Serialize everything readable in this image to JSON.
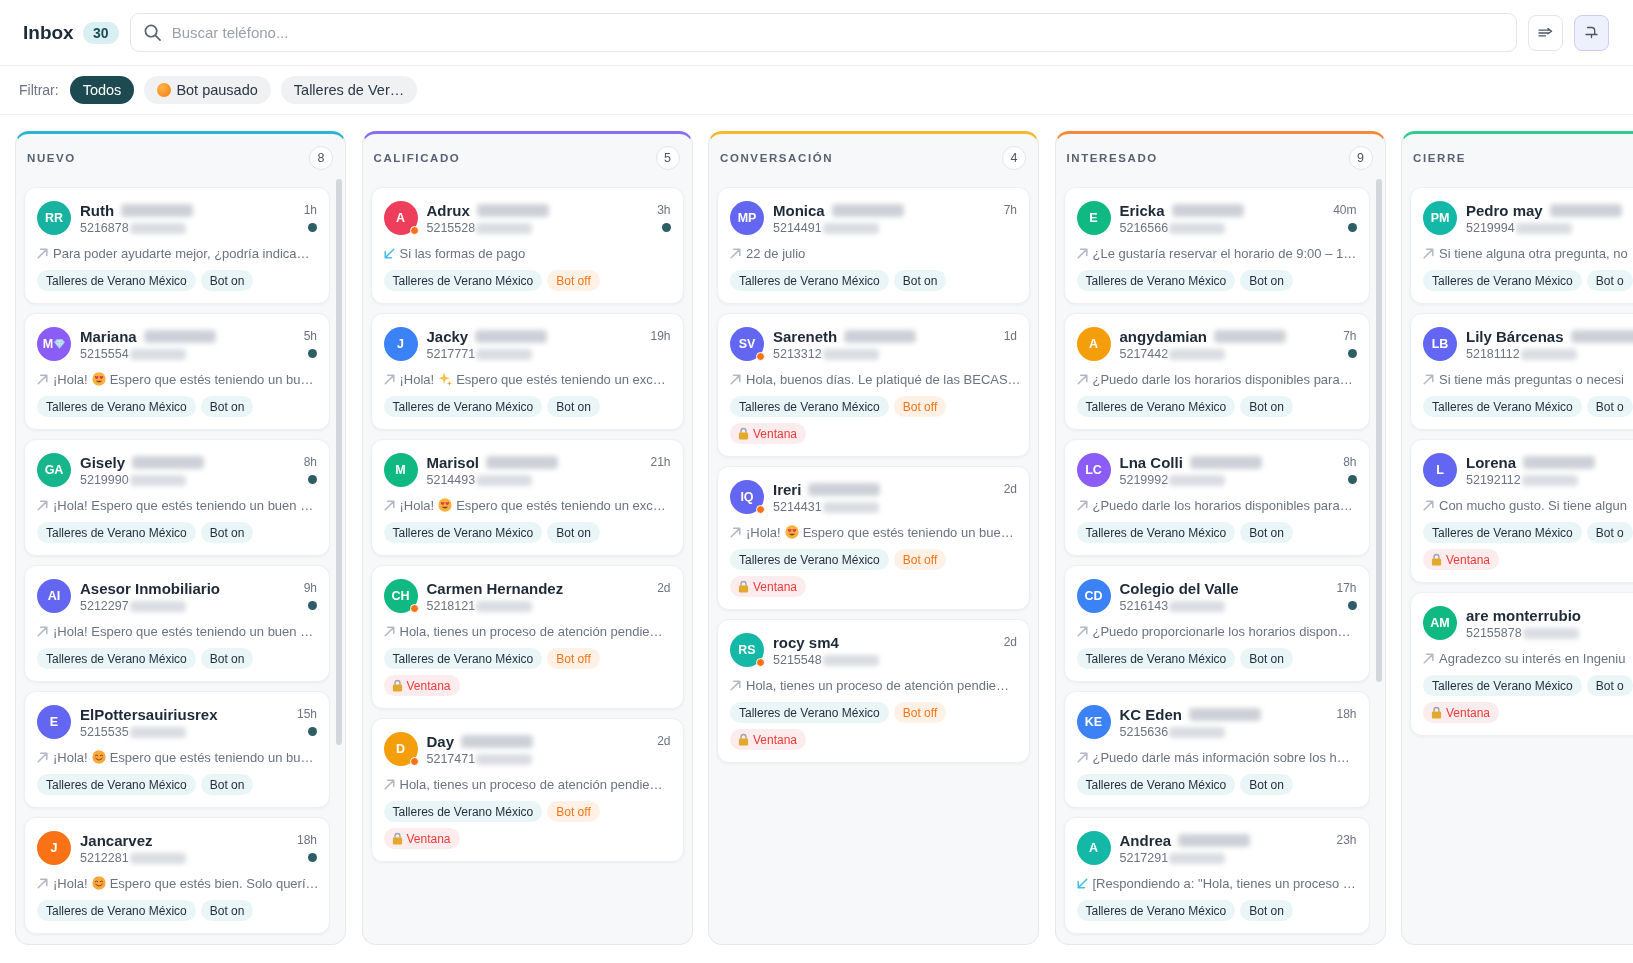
{
  "header": {
    "title": "Inbox",
    "count": "30",
    "search": {
      "placeholder": "Buscar teléfono..."
    },
    "toolbar": [
      {
        "kind": "sort",
        "on": false
      },
      {
        "kind": "lamp",
        "on": true
      }
    ]
  },
  "filters": {
    "label": "Filtrar:",
    "chips": [
      {
        "label": "Todos",
        "selected": true,
        "dot": false
      },
      {
        "label": "Bot pausado",
        "selected": false,
        "dot": true
      },
      {
        "label": "Talleres de Ver…",
        "selected": false,
        "dot": false
      }
    ]
  },
  "columns": [
    {
      "title": "NUEVO",
      "count": "8",
      "color": "#2bb5d2",
      "cards": [
        {
          "initials": "RR",
          "color": "#17b3a0",
          "name": "Ruth",
          "name_redacted": true,
          "phone": "5216878",
          "time": "1h",
          "unread": true,
          "paused": false,
          "incoming": false,
          "preview": [
            {
              "kind": "text",
              "text": "Para poder ayudarte mejor, ¿podría indica…"
            }
          ],
          "tags": [
            {
              "label": "Talleres de Verano México",
              "kind": "group"
            },
            {
              "label": "Bot on",
              "kind": "on"
            }
          ]
        },
        {
          "initials": "M",
          "emblem": {
            "kind": "gem"
          },
          "color": "#8b5cf6",
          "name": "Mariana",
          "name_redacted": true,
          "phone": "5215554",
          "time": "5h",
          "unread": true,
          "paused": false,
          "incoming": false,
          "preview": [
            {
              "kind": "text",
              "text": "¡Hola!"
            },
            {
              "kind": "hearts"
            },
            {
              "kind": "text",
              "text": "Espero que estés teniendo un bu…"
            }
          ],
          "tags": [
            {
              "label": "Talleres de Verano México",
              "kind": "group"
            },
            {
              "label": "Bot on",
              "kind": "on"
            }
          ]
        },
        {
          "initials": "GA",
          "color": "#16b58c",
          "name": "Gisely",
          "name_redacted": true,
          "phone": "5219990",
          "time": "8h",
          "unread": true,
          "paused": false,
          "incoming": false,
          "preview": [
            {
              "kind": "text",
              "text": "¡Hola! Espero que estés teniendo un buen …"
            }
          ],
          "tags": [
            {
              "label": "Talleres de Verano México",
              "kind": "group"
            },
            {
              "label": "Bot on",
              "kind": "on"
            }
          ]
        },
        {
          "initials": "AI",
          "color": "#6366f1",
          "name": "Asesor Inmobiliario",
          "name_redacted": false,
          "phone": "5212297",
          "time": "9h",
          "unread": true,
          "paused": false,
          "incoming": false,
          "preview": [
            {
              "kind": "text",
              "text": "¡Hola! Espero que estés teniendo un buen …"
            }
          ],
          "tags": [
            {
              "label": "Talleres de Verano México",
              "kind": "group"
            },
            {
              "label": "Bot on",
              "kind": "on"
            }
          ]
        },
        {
          "initials": "E",
          "color": "#6366f1",
          "name": "ElPottersauiriusrex",
          "name_redacted": false,
          "phone": "5215535",
          "time": "15h",
          "unread": true,
          "paused": false,
          "incoming": false,
          "preview": [
            {
              "kind": "text",
              "text": "¡Hola!"
            },
            {
              "kind": "smile"
            },
            {
              "kind": "text",
              "text": "Espero que estés teniendo un bu…"
            }
          ],
          "tags": [
            {
              "label": "Talleres de Verano México",
              "kind": "group"
            },
            {
              "label": "Bot on",
              "kind": "on"
            }
          ]
        },
        {
          "initials": "J",
          "color": "#f97316",
          "name": "Jancarvez",
          "name_redacted": false,
          "phone": "5212281",
          "time": "18h",
          "unread": true,
          "paused": false,
          "incoming": false,
          "preview": [
            {
              "kind": "text",
              "text": "¡Hola!"
            },
            {
              "kind": "smile"
            },
            {
              "kind": "text",
              "text": "Espero que estés bien. Solo querí…"
            }
          ],
          "tags": [
            {
              "label": "Talleres de Verano México",
              "kind": "group"
            },
            {
              "label": "Bot on",
              "kind": "on"
            }
          ]
        }
      ]
    },
    {
      "title": "CALIFICADO",
      "count": "5",
      "color": "#8b6cf2",
      "cards": [
        {
          "initials": "A",
          "color": "#ef3e5c",
          "name": "Adrux",
          "name_redacted": true,
          "phone": "5215528",
          "time": "3h",
          "unread": true,
          "paused": true,
          "incoming": true,
          "preview": [
            {
              "kind": "text",
              "text": "Si las formas de pago"
            }
          ],
          "tags": [
            {
              "label": "Talleres de Verano México",
              "kind": "group"
            },
            {
              "label": "Bot off",
              "kind": "off"
            }
          ]
        },
        {
          "initials": "J",
          "color": "#3b82f6",
          "name": "Jacky",
          "name_redacted": true,
          "phone": "5217771",
          "time": "19h",
          "unread": false,
          "paused": false,
          "incoming": false,
          "preview": [
            {
              "kind": "text",
              "text": "¡Hola!"
            },
            {
              "kind": "sparkles"
            },
            {
              "kind": "text",
              "text": "Espero que estés teniendo un exc…"
            }
          ],
          "tags": [
            {
              "label": "Talleres de Verano México",
              "kind": "group"
            },
            {
              "label": "Bot on",
              "kind": "on"
            }
          ]
        },
        {
          "initials": "M",
          "color": "#10b981",
          "name": "Marisol",
          "name_redacted": true,
          "phone": "5214493",
          "time": "21h",
          "unread": false,
          "paused": false,
          "incoming": false,
          "preview": [
            {
              "kind": "text",
              "text": "¡Hola!"
            },
            {
              "kind": "hearts"
            },
            {
              "kind": "text",
              "text": "Espero que estés teniendo un exc…"
            }
          ],
          "tags": [
            {
              "label": "Talleres de Verano México",
              "kind": "group"
            },
            {
              "label": "Bot on",
              "kind": "on"
            }
          ]
        },
        {
          "initials": "CH",
          "color": "#10b981",
          "name": "Carmen Hernandez",
          "name_redacted": false,
          "phone": "5218121",
          "time": "2d",
          "unread": false,
          "paused": true,
          "incoming": false,
          "preview": [
            {
              "kind": "text",
              "text": "Hola, tienes un proceso de atención pendie…"
            }
          ],
          "tags": [
            {
              "label": "Talleres de Verano México",
              "kind": "group"
            },
            {
              "label": "Bot off",
              "kind": "off"
            },
            {
              "label": "Ventana",
              "kind": "window"
            }
          ]
        },
        {
          "initials": "D",
          "color": "#f59e0b",
          "name": "Day",
          "name_redacted": true,
          "phone": "5217471",
          "time": "2d",
          "unread": false,
          "paused": true,
          "incoming": false,
          "preview": [
            {
              "kind": "text",
              "text": "Hola, tienes un proceso de atención pendie…"
            }
          ],
          "tags": [
            {
              "label": "Talleres de Verano México",
              "kind": "group"
            },
            {
              "label": "Bot off",
              "kind": "off"
            },
            {
              "label": "Ventana",
              "kind": "window"
            }
          ]
        }
      ]
    },
    {
      "title": "CONVERSACIÓN",
      "count": "4",
      "color": "#f5b82e",
      "cards": [
        {
          "initials": "MP",
          "color": "#6366f1",
          "name": "Monica",
          "name_redacted": true,
          "phone": "5214491",
          "time": "7h",
          "unread": false,
          "paused": false,
          "incoming": false,
          "preview": [
            {
              "kind": "text",
              "text": "22 de julio"
            }
          ],
          "tags": [
            {
              "label": "Talleres de Verano México",
              "kind": "group"
            },
            {
              "label": "Bot on",
              "kind": "on"
            }
          ]
        },
        {
          "initials": "SV",
          "color": "#6366f1",
          "name": "Sareneth",
          "name_redacted": true,
          "phone": "5213312",
          "time": "1d",
          "unread": false,
          "paused": true,
          "incoming": false,
          "preview": [
            {
              "kind": "text",
              "text": "Hola, buenos días. Le platiqué de las BECAS…"
            }
          ],
          "tags": [
            {
              "label": "Talleres de Verano México",
              "kind": "group"
            },
            {
              "label": "Bot off",
              "kind": "off"
            },
            {
              "label": "Ventana",
              "kind": "window"
            }
          ]
        },
        {
          "initials": "IQ",
          "color": "#6366f1",
          "name": "Ireri",
          "name_redacted": true,
          "phone": "5214431",
          "time": "2d",
          "unread": false,
          "paused": true,
          "incoming": false,
          "preview": [
            {
              "kind": "text",
              "text": "¡Hola!"
            },
            {
              "kind": "hearts"
            },
            {
              "kind": "text",
              "text": "Espero que estés teniendo un bue…"
            }
          ],
          "tags": [
            {
              "label": "Talleres de Verano México",
              "kind": "group"
            },
            {
              "label": "Bot off",
              "kind": "off"
            },
            {
              "label": "Ventana",
              "kind": "window"
            }
          ]
        },
        {
          "initials": "RS",
          "color": "#14b8a6",
          "name": "rocy sm4",
          "name_redacted": false,
          "phone": "5215548",
          "time": "2d",
          "unread": false,
          "paused": true,
          "incoming": false,
          "preview": [
            {
              "kind": "text",
              "text": "Hola, tienes un proceso de atención pendie…"
            }
          ],
          "tags": [
            {
              "label": "Talleres de Verano México",
              "kind": "group"
            },
            {
              "label": "Bot off",
              "kind": "off"
            },
            {
              "label": "Ventana",
              "kind": "window"
            }
          ]
        }
      ]
    },
    {
      "title": "INTERESADO",
      "count": "9",
      "color": "#f7893b",
      "cards": [
        {
          "initials": "E",
          "color": "#10b981",
          "name": "Ericka",
          "name_redacted": true,
          "phone": "5216566",
          "time": "40m",
          "unread": true,
          "paused": false,
          "incoming": false,
          "preview": [
            {
              "kind": "text",
              "text": "¿Le gustaría reservar el horario de 9:00 – 1…"
            }
          ],
          "tags": [
            {
              "label": "Talleres de Verano México",
              "kind": "group"
            },
            {
              "label": "Bot on",
              "kind": "on"
            }
          ]
        },
        {
          "initials": "A",
          "color": "#f59e0b",
          "name": "angydamian",
          "name_redacted": true,
          "phone": "5217442",
          "time": "7h",
          "unread": true,
          "paused": false,
          "incoming": false,
          "preview": [
            {
              "kind": "text",
              "text": "¿Puedo darle los horarios disponibles para…"
            }
          ],
          "tags": [
            {
              "label": "Talleres de Verano México",
              "kind": "group"
            },
            {
              "label": "Bot on",
              "kind": "on"
            }
          ]
        },
        {
          "initials": "LC",
          "color": "#8b5cf6",
          "name": "Lna Colli",
          "name_redacted": true,
          "phone": "5219992",
          "time": "8h",
          "unread": true,
          "paused": false,
          "incoming": false,
          "preview": [
            {
              "kind": "text",
              "text": "¿Puedo darle los horarios disponibles para…"
            }
          ],
          "tags": [
            {
              "label": "Talleres de Verano México",
              "kind": "group"
            },
            {
              "label": "Bot on",
              "kind": "on"
            }
          ]
        },
        {
          "initials": "CD",
          "color": "#3b82f6",
          "name": "Colegio del Valle",
          "name_redacted": false,
          "phone": "5216143",
          "time": "17h",
          "unread": true,
          "paused": false,
          "incoming": false,
          "preview": [
            {
              "kind": "text",
              "text": "¿Puedo proporcionarle los horarios dispon…"
            }
          ],
          "tags": [
            {
              "label": "Talleres de Verano México",
              "kind": "group"
            },
            {
              "label": "Bot on",
              "kind": "on"
            }
          ]
        },
        {
          "initials": "KE",
          "color": "#3b82f6",
          "name": "KC Eden",
          "name_redacted": true,
          "phone": "5215636",
          "time": "18h",
          "unread": false,
          "paused": false,
          "incoming": false,
          "preview": [
            {
              "kind": "text",
              "text": "¿Puedo darle más información sobre los h…"
            }
          ],
          "tags": [
            {
              "label": "Talleres de Verano México",
              "kind": "group"
            },
            {
              "label": "Bot on",
              "kind": "on"
            }
          ]
        },
        {
          "initials": "A",
          "color": "#14b8a6",
          "name": "Andrea",
          "name_redacted": true,
          "phone": "5217291",
          "time": "23h",
          "unread": false,
          "paused": false,
          "incoming": true,
          "preview": [
            {
              "kind": "text",
              "text": "[Respondiendo a: \"Hola, tienes un proceso …"
            }
          ],
          "tags": [
            {
              "label": "Talleres de Verano México",
              "kind": "group"
            },
            {
              "label": "Bot on",
              "kind": "on"
            }
          ]
        }
      ]
    },
    {
      "title": "CIERRE",
      "color": "#2ecf8e",
      "cards": [
        {
          "initials": "PM",
          "color": "#14b8a6",
          "name": "Pedro may",
          "name_redacted": true,
          "phone": "5219994",
          "paused": false,
          "incoming": false,
          "preview": [
            {
              "kind": "text",
              "text": "Si tiene alguna otra pregunta, no"
            }
          ],
          "tags": [
            {
              "label": "Talleres de Verano México",
              "kind": "group"
            },
            {
              "label": "Bot o",
              "kind": "on"
            }
          ]
        },
        {
          "initials": "LB",
          "color": "#6366f1",
          "name": "Lily Bárcenas",
          "name_redacted": true,
          "phone": "52181112",
          "paused": false,
          "incoming": false,
          "preview": [
            {
              "kind": "text",
              "text": "Si tiene más preguntas o necesi"
            }
          ],
          "tags": [
            {
              "label": "Talleres de Verano México",
              "kind": "group"
            },
            {
              "label": "Bot o",
              "kind": "on"
            }
          ]
        },
        {
          "initials": "L",
          "color": "#6366f1",
          "name": "Lorena",
          "name_redacted": true,
          "phone": "52192112",
          "paused": false,
          "incoming": false,
          "preview": [
            {
              "kind": "text",
              "text": "Con mucho gusto. Si tiene algun"
            }
          ],
          "tags": [
            {
              "label": "Talleres de Verano México",
              "kind": "group"
            },
            {
              "label": "Bot o",
              "kind": "on"
            },
            {
              "label": "Ventana",
              "kind": "window"
            }
          ]
        },
        {
          "initials": "AM",
          "color": "#10b981",
          "name": "are monterrubio",
          "name_redacted": false,
          "phone": "52155878",
          "paused": false,
          "incoming": false,
          "preview": [
            {
              "kind": "text",
              "text": "Agradezco su interés en Ingeniu"
            }
          ],
          "tags": [
            {
              "label": "Talleres de Verano México",
              "kind": "group"
            },
            {
              "label": "Bot o",
              "kind": "on"
            },
            {
              "label": "Ventana",
              "kind": "window"
            }
          ]
        }
      ]
    }
  ]
}
